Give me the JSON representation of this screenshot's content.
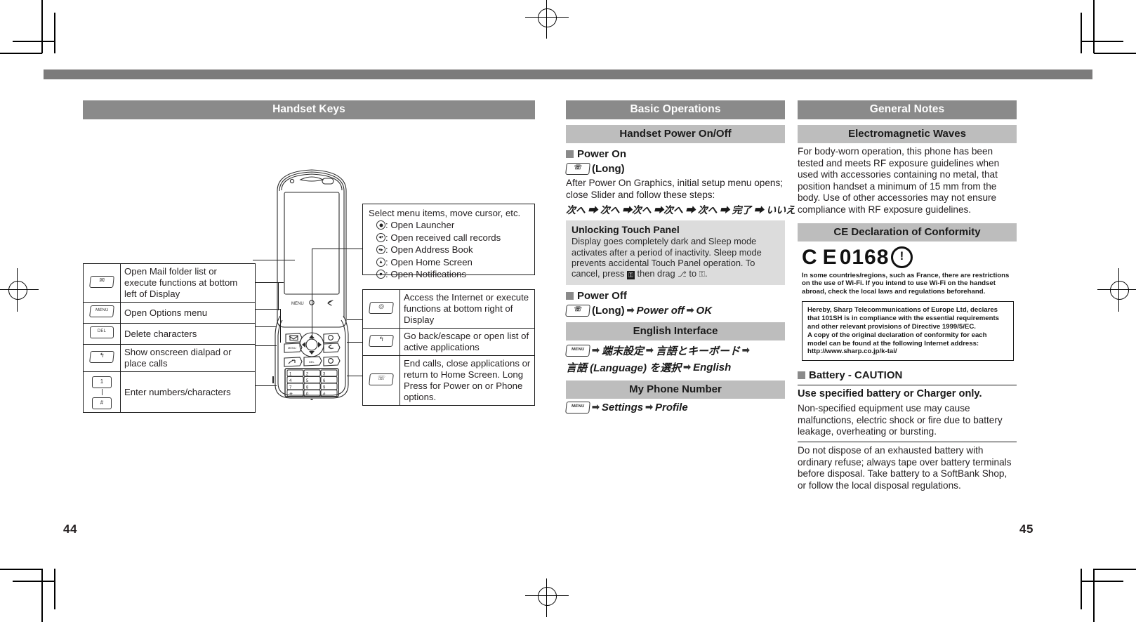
{
  "document": {
    "page_left": "44",
    "page_right": "45"
  },
  "left_page": {
    "section_title": "Handset Keys",
    "dpad_callout": {
      "intro": "Select menu items, move cursor, etc.",
      "items": [
        {
          "icon": "dpad-center-icon",
          "label": ": Open Launcher"
        },
        {
          "icon": "dpad-left-icon",
          "label": ": Open received call records"
        },
        {
          "icon": "dpad-right-icon",
          "label": ": Open Address Book"
        },
        {
          "icon": "dpad-up-icon",
          "label": ": Open Home Screen"
        },
        {
          "icon": "dpad-down-icon",
          "label": ": Open Notifications"
        }
      ]
    },
    "keys_left": [
      {
        "key_icon": "mail-key-icon",
        "key_label": "✉",
        "desc": "Open Mail folder list or execute functions at bottom left of Display"
      },
      {
        "key_icon": "menu-key-icon",
        "key_label": "MENU",
        "desc": "Open Options menu"
      },
      {
        "key_icon": "delete-key-icon",
        "key_label": "DEL",
        "desc": "Delete characters"
      },
      {
        "key_icon": "call-key-icon",
        "key_label": "↖",
        "desc": "Show onscreen dialpad or place calls"
      },
      {
        "key_icon": "keypad-keys-icon",
        "key_label": "1 … #",
        "desc": "Enter numbers/characters"
      }
    ],
    "keys_right": [
      {
        "key_icon": "internet-key-icon",
        "key_label": "◎",
        "desc": "Access the Internet or execute functions at bottom right of Display"
      },
      {
        "key_icon": "back-key-icon",
        "key_label": "↩",
        "desc": "Go back/escape or open list of active applications"
      },
      {
        "key_icon": "power-end-key-icon",
        "key_label": "⏻",
        "desc": "End calls, close applications or return to Home Screen. Long Press for Power on or Phone options."
      }
    ],
    "handset_labels": {
      "soft_menu": "MENU",
      "soft_home": "○",
      "soft_back": "↩"
    }
  },
  "mid_column": {
    "section_title": "Basic Operations",
    "power_section_title": "Handset Power On/Off",
    "power_on": {
      "heading": "Power On",
      "key_label": "(Long)",
      "body": "After Power On Graphics, initial setup menu opens; close Slider and follow these steps:",
      "steps": "次へ ➡ 次へ ➡次へ ➡次へ ➡ 次へ ➡ 完了 ➡ いいえ"
    },
    "touch_panel_note": {
      "title": "Unlocking Touch Panel",
      "body_part1": "Display goes completely dark and Sleep mode activates after a period of inactivity. Sleep mode prevents accidental Touch Panel operation. To cancel, press",
      "inline_key": "⚿",
      "body_part2": "then drag",
      "drag_icon": "⎇",
      "body_part3": "to",
      "target_icon": "⚿",
      "body_part4": "."
    },
    "power_off": {
      "heading": "Power Off",
      "key_label": "(Long)",
      "step1": "Power off",
      "step2": "OK"
    },
    "english_interface": {
      "title": "English Interface",
      "step1": "端末設定",
      "step2": "言語とキーボード",
      "step3": "言語 (Language) を選択",
      "step4": "English"
    },
    "my_phone_number": {
      "title": "My Phone Number",
      "step1": "Settings",
      "step2": "Profile"
    }
  },
  "right_column": {
    "section_title": "General Notes",
    "electromagnetic": {
      "title": "Electromagnetic Waves",
      "body": "For body-worn operation, this phone has been tested and meets RF exposure guidelines when used with accessories containing no metal, that position handset a minimum of 15 mm from the body. Use of other accessories may not ensure compliance with RF exposure guidelines."
    },
    "ce_declaration": {
      "title": "CE Declaration of Conformity",
      "logo_text": "0168",
      "ce_mark": "C E",
      "alert_mark": "!",
      "fine_print": "In some countries/regions, such as France, there are restrictions on the use of Wi-Fi. If you intend to use Wi-Fi on the handset abroad, check the local laws and regulations beforehand.",
      "declaration_box": "Hereby, Sharp Telecommunications of Europe Ltd, declares that 101SH is in compliance with the essential requirements and other relevant provisions of Directive 1999/5/EC.\nA copy of the original declaration of conformity for each model can be found at the following Internet address:\nhttp://www.sharp.co.jp/k-tai/"
    },
    "battery": {
      "heading": "Battery - CAUTION",
      "lead": "Use specified battery or Charger only.",
      "body1": "Non-specified equipment use may cause malfunctions, electric shock or fire due to battery leakage, overheating or bursting.",
      "body2": "Do not dispose of an exhausted battery with ordinary refuse; always tape over battery terminals before disposal. Take battery to a SoftBank Shop, or follow the local disposal regulations."
    }
  },
  "colors": {
    "bar_dark": "#8a8a8a",
    "bar_light": "#bdbdbd",
    "note_bg": "#dcdcdc",
    "text": "#231f20"
  }
}
